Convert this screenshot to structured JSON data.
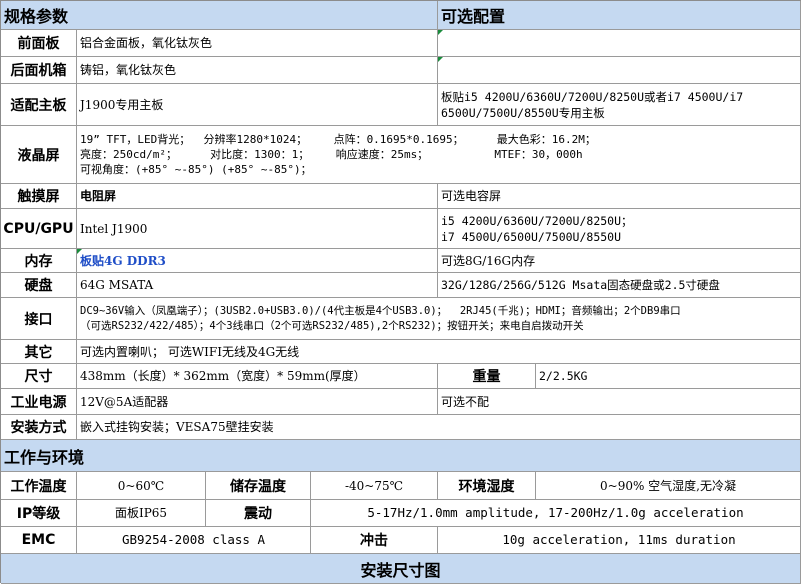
{
  "header": {
    "spec_title": "规格参数",
    "option_title": "可选配置"
  },
  "rows": {
    "front_panel": {
      "label": "前面板",
      "value": "铝合金面板，氧化钛灰色"
    },
    "rear_case": {
      "label": "后面机箱",
      "value": "铸铝，氧化钛灰色"
    },
    "mainboard": {
      "label": "适配主板",
      "value": "J1900专用主板",
      "option": "板贴i5 4200U/6360U/7200U/8250U或者i7 4500U/i7\n6500U/7500U/8550U专用主板"
    },
    "lcd": {
      "label": "液晶屏",
      "value": "19” TFT，LED背光；  分辨率1280*1024；    点阵：0.1695*0.1695；     最大色彩：16.2M；\n亮度：250cd/m²；     对比度：1300：1；    响应速度：25ms；          MTEF：30，000h\n可视角度：(+85° ~-85°) (+85° ~-85°)；"
    },
    "touch": {
      "label": "触摸屏",
      "value": "电阻屏",
      "option": "可选电容屏"
    },
    "cpu": {
      "label": "CPU/GPU",
      "value": "Intel J1900",
      "option": "i5 4200U/6360U/7200U/8250U；\ni7 4500U/6500U/7500U/8550U"
    },
    "memory": {
      "label": "内存",
      "value": "板贴4G DDR3",
      "option": "可选8G/16G内存"
    },
    "disk": {
      "label": "硬盘",
      "value": "64G MSATA",
      "option": "32G/128G/256G/512G Msata固态硬盘或2.5寸硬盘"
    },
    "ports": {
      "label": "接口",
      "value": "DC9~36V输入（凤凰端子）；(3USB2.0+USB3.0)/(4代主板是4个USB3.0)；  2RJ45(千兆)；HDMI；音频输出；2个DB9串口\n（可选RS232/422/485）；4个3线串口（2个可选RS232/485),2个RS232)；按钮开关；来电自启拨动开关"
    },
    "other": {
      "label": "其它",
      "value": "可选内置喇叭；  可选WIFI无线及4G无线"
    },
    "size": {
      "label": "尺寸",
      "value": "438mm（长度）* 362mm（宽度）* 59mm(厚度）",
      "weight_label": "重量",
      "weight_value": "2/2.5KG"
    },
    "power": {
      "label": "工业电源",
      "value": "12V@5A适配器",
      "option": "可选不配"
    },
    "mount": {
      "label": "安装方式",
      "value": "嵌入式挂钩安装；VESA75壁挂安装"
    }
  },
  "env": {
    "title": "工作与环境",
    "work_temp_label": "工作温度",
    "work_temp": "0~60℃",
    "storage_temp_label": "储存温度",
    "storage_temp": "-40~75℃",
    "humidity_label": "环境湿度",
    "humidity": "0~90% 空气湿度,无冷凝",
    "ip_label": "IP等级",
    "ip": "面板IP65",
    "vibration_label": "震动",
    "vibration": "5-17Hz/1.0mm amplitude, 17-200Hz/1.0g acceleration",
    "emc_label": "EMC",
    "emc": "GB9254-2008 class A",
    "shock_label": "冲击",
    "shock": "10g acceleration, 11ms duration"
  },
  "footer": {
    "title": "安装尺寸图"
  }
}
